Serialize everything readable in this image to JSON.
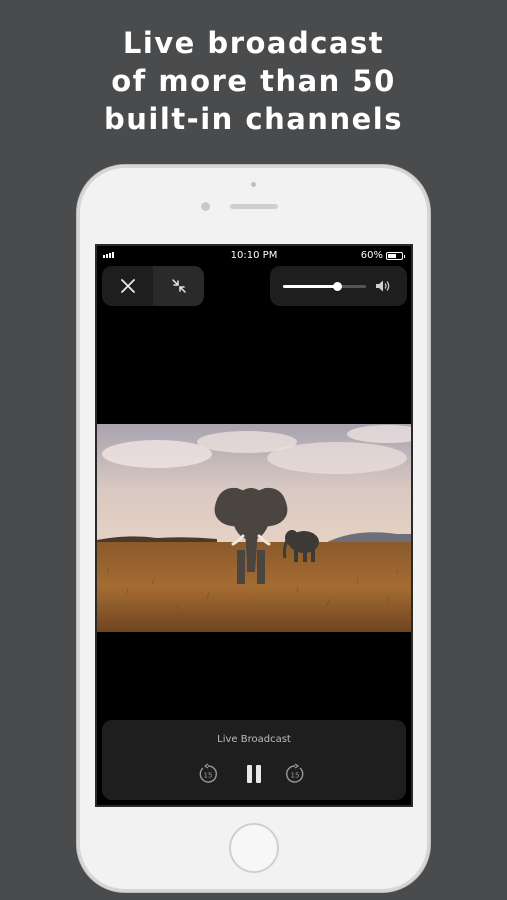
{
  "headline": {
    "line1": "Live broadcast",
    "line2": "of more than 50",
    "line3": "built-in channels"
  },
  "status_bar": {
    "time": "10:10 PM",
    "battery_percent": "60%",
    "battery_level": 0.6
  },
  "player": {
    "title": "Live Broadcast",
    "volume_level": 0.65,
    "skip_back_seconds": "15",
    "skip_forward_seconds": "15",
    "state": "playing"
  },
  "icons": {
    "close": "close-icon",
    "minimize": "minimize-icon",
    "volume": "speaker-icon",
    "skip_back": "rewind-15-icon",
    "pause": "pause-icon",
    "skip_forward": "forward-15-icon"
  },
  "colors": {
    "background": "#4a4b4d",
    "phone_body": "#f2f2f2",
    "screen": "#000000",
    "panel": "#1e1e1e"
  }
}
